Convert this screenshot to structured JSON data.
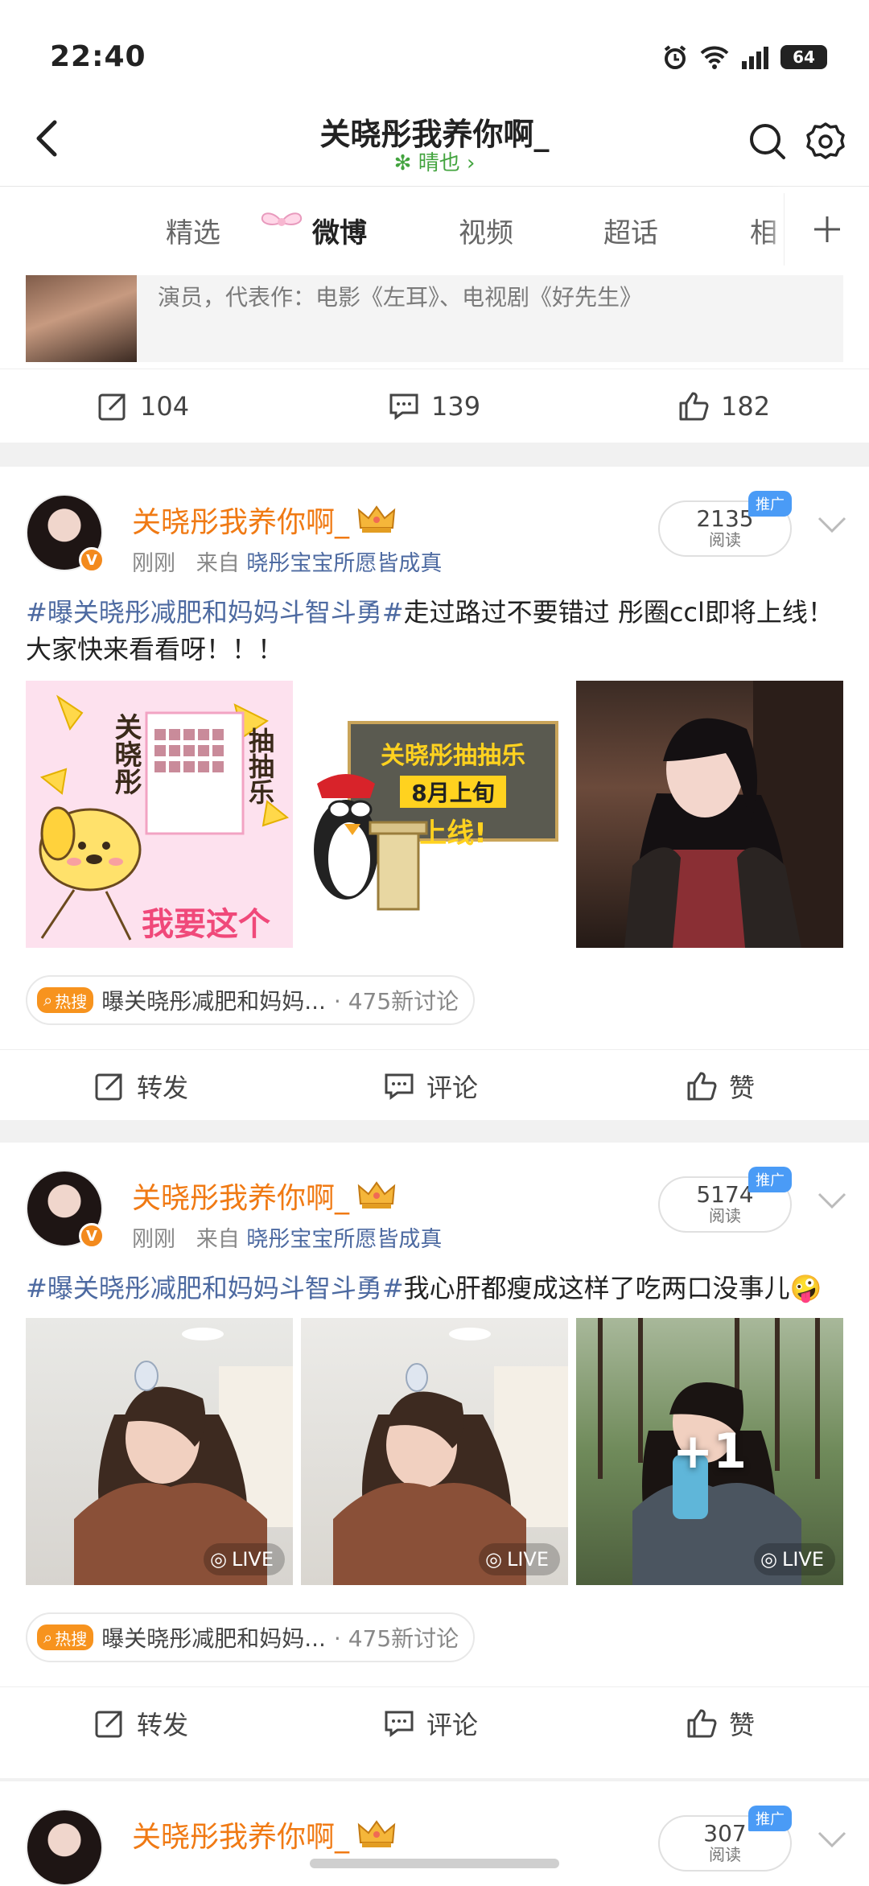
{
  "status_bar": {
    "time": "22:40",
    "battery": "64"
  },
  "header": {
    "title": "关晓彤我养你啊_",
    "subtitle": "晴也 ›"
  },
  "tabs": [
    "精选",
    "微博",
    "视频",
    "超话",
    "相"
  ],
  "top_card": {
    "quote_desc": "演员，代表作：电影《左耳》、电视剧《好先生》",
    "repost_count": "104",
    "comment_count": "139",
    "like_count": "182"
  },
  "posts": [
    {
      "username": "关晓彤我养你啊_",
      "time": "刚刚",
      "source_prefix": "来自",
      "source": "晓彤宝宝所愿皆成真",
      "reads": "2135",
      "reads_label": "阅读",
      "promo": "推广",
      "hashtag": "#曝关晓彤减肥和妈妈斗智斗勇#",
      "body": "走过路过不要错过 彤圈ccl即将上线！大家快来看看呀！！！",
      "images": [
        {
          "caption_vertical_1": "关晓彤",
          "caption_vertical_2": "抽抽乐",
          "caption_bottom": "我要这个"
        },
        {
          "board_line1": "关晓彤抽抽乐",
          "board_line2": "8月上旬",
          "board_line3": "上线!"
        },
        {}
      ],
      "hot_badge": "热搜",
      "hot_topic": "曝关晓彤减肥和妈妈...",
      "hot_count": "· 475新讨论",
      "actions": {
        "repost": "转发",
        "comment": "评论",
        "like": "赞"
      }
    },
    {
      "username": "关晓彤我养你啊_",
      "time": "刚刚",
      "source_prefix": "来自",
      "source": "晓彤宝宝所愿皆成真",
      "reads": "5174",
      "reads_label": "阅读",
      "promo": "推广",
      "hashtag": "#曝关晓彤减肥和妈妈斗智斗勇#",
      "body": "我心肝都瘦成这样了吃两口没事儿🤪",
      "live_label": "LIVE",
      "more_count": "+1",
      "hot_badge": "热搜",
      "hot_topic": "曝关晓彤减肥和妈妈...",
      "hot_count": "· 475新讨论",
      "actions": {
        "repost": "转发",
        "comment": "评论",
        "like": "赞"
      }
    },
    {
      "username": "关晓彤我养你啊_",
      "reads": "307",
      "reads_label": "阅读",
      "promo": "推广"
    }
  ],
  "colors": {
    "accent": "#f07a14",
    "link": "#4d6aa1",
    "hot": "#f7931e",
    "promo": "#4a9bf6"
  }
}
